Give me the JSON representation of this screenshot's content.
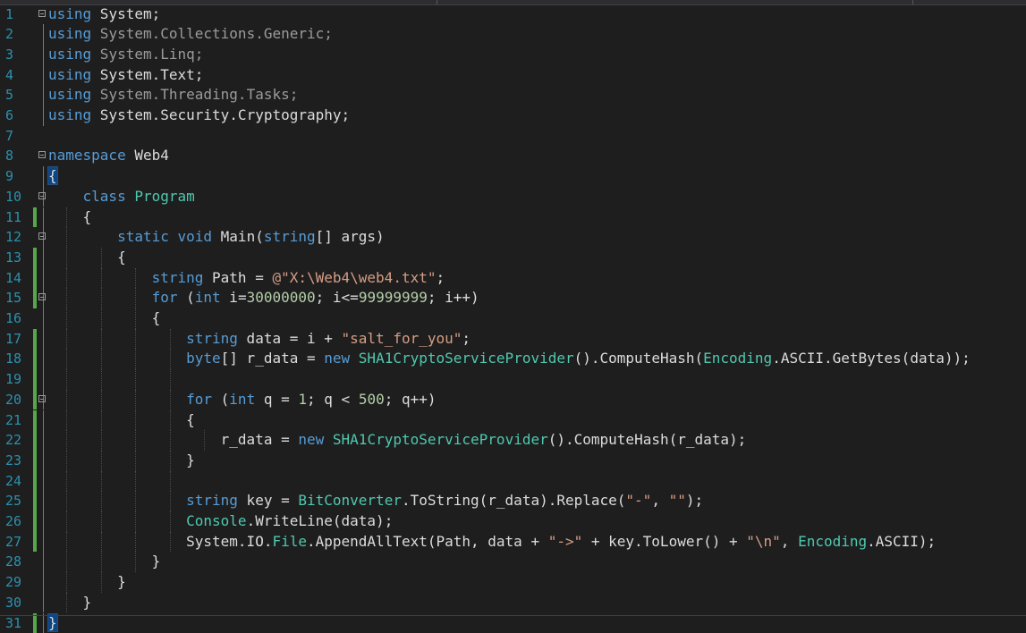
{
  "editor": {
    "lines": [
      {
        "num": "1",
        "fold": true,
        "change": false,
        "guides": [],
        "outline": false,
        "tokens": [
          [
            "kw",
            "using"
          ],
          [
            "pl",
            " System;"
          ]
        ]
      },
      {
        "num": "2",
        "fold": false,
        "change": false,
        "guides": [],
        "outline": true,
        "tokens": [
          [
            "kw",
            "using"
          ],
          [
            "dim",
            " System.Collections.Generic;"
          ]
        ]
      },
      {
        "num": "3",
        "fold": false,
        "change": false,
        "guides": [],
        "outline": true,
        "tokens": [
          [
            "kw",
            "using"
          ],
          [
            "dim",
            " System.Linq;"
          ]
        ]
      },
      {
        "num": "4",
        "fold": false,
        "change": false,
        "guides": [],
        "outline": true,
        "tokens": [
          [
            "kw",
            "using"
          ],
          [
            "pl",
            " System.Text;"
          ]
        ]
      },
      {
        "num": "5",
        "fold": false,
        "change": false,
        "guides": [],
        "outline": true,
        "tokens": [
          [
            "kw",
            "using"
          ],
          [
            "dim",
            " System.Threading.Tasks;"
          ]
        ]
      },
      {
        "num": "6",
        "fold": false,
        "change": false,
        "guides": [],
        "outline": true,
        "tokens": [
          [
            "kw",
            "using"
          ],
          [
            "pl",
            " System.Security.Cryptography;"
          ]
        ]
      },
      {
        "num": "7",
        "fold": false,
        "change": false,
        "guides": [],
        "outline": false,
        "tokens": []
      },
      {
        "num": "8",
        "fold": true,
        "change": false,
        "guides": [],
        "outline": false,
        "tokens": [
          [
            "kw",
            "namespace"
          ],
          [
            "pl",
            " Web4"
          ]
        ]
      },
      {
        "num": "9",
        "fold": false,
        "change": false,
        "guides": [],
        "outline": true,
        "tokens": [
          [
            "hl",
            "{"
          ]
        ]
      },
      {
        "num": "10",
        "fold": true,
        "change": false,
        "guides": [],
        "outline": true,
        "tokens": [
          [
            "pl",
            "    "
          ],
          [
            "kw",
            "class"
          ],
          [
            "pl",
            " "
          ],
          [
            "ty",
            "Program"
          ]
        ]
      },
      {
        "num": "11",
        "fold": false,
        "change": true,
        "guides": [
          1
        ],
        "outline": true,
        "tokens": [
          [
            "pl",
            "    {"
          ]
        ]
      },
      {
        "num": "12",
        "fold": true,
        "change": false,
        "guides": [
          1
        ],
        "outline": true,
        "tokens": [
          [
            "pl",
            "        "
          ],
          [
            "kw",
            "static"
          ],
          [
            "pl",
            " "
          ],
          [
            "kw",
            "void"
          ],
          [
            "pl",
            " Main("
          ],
          [
            "kw",
            "string"
          ],
          [
            "pl",
            "[] args)"
          ]
        ]
      },
      {
        "num": "13",
        "fold": false,
        "change": true,
        "guides": [
          1,
          2
        ],
        "outline": true,
        "tokens": [
          [
            "pl",
            "        {"
          ]
        ]
      },
      {
        "num": "14",
        "fold": false,
        "change": true,
        "guides": [
          1,
          2,
          3
        ],
        "outline": true,
        "tokens": [
          [
            "pl",
            "            "
          ],
          [
            "kw",
            "string"
          ],
          [
            "pl",
            " Path = "
          ],
          [
            "st",
            "@\"X:\\Web4\\web4.txt\""
          ],
          [
            "pl",
            ";"
          ]
        ]
      },
      {
        "num": "15",
        "fold": true,
        "change": true,
        "guides": [
          1,
          2,
          3
        ],
        "outline": true,
        "tokens": [
          [
            "pl",
            "            "
          ],
          [
            "kw",
            "for"
          ],
          [
            "pl",
            " ("
          ],
          [
            "kw",
            "int"
          ],
          [
            "pl",
            " i="
          ],
          [
            "nu",
            "30000000"
          ],
          [
            "pl",
            "; i<="
          ],
          [
            "nu",
            "99999999"
          ],
          [
            "pl",
            "; i++)"
          ]
        ]
      },
      {
        "num": "16",
        "fold": false,
        "change": false,
        "guides": [
          1,
          2,
          3
        ],
        "outline": true,
        "tokens": [
          [
            "pl",
            "            {"
          ]
        ]
      },
      {
        "num": "17",
        "fold": false,
        "change": true,
        "guides": [
          1,
          2,
          3,
          4
        ],
        "outline": true,
        "tokens": [
          [
            "pl",
            "                "
          ],
          [
            "kw",
            "string"
          ],
          [
            "pl",
            " data = i + "
          ],
          [
            "st",
            "\"salt_for_you\""
          ],
          [
            "pl",
            ";"
          ]
        ]
      },
      {
        "num": "18",
        "fold": false,
        "change": true,
        "guides": [
          1,
          2,
          3,
          4
        ],
        "outline": true,
        "tokens": [
          [
            "pl",
            "                "
          ],
          [
            "kw",
            "byte"
          ],
          [
            "pl",
            "[] r_data = "
          ],
          [
            "kw",
            "new"
          ],
          [
            "pl",
            " "
          ],
          [
            "ty",
            "SHA1CryptoServiceProvider"
          ],
          [
            "pl",
            "().ComputeHash("
          ],
          [
            "ty",
            "Encoding"
          ],
          [
            "pl",
            ".ASCII.GetBytes(data));"
          ]
        ]
      },
      {
        "num": "19",
        "fold": false,
        "change": true,
        "guides": [
          1,
          2,
          3,
          4
        ],
        "outline": true,
        "tokens": []
      },
      {
        "num": "20",
        "fold": true,
        "change": true,
        "guides": [
          1,
          2,
          3,
          4
        ],
        "outline": true,
        "tokens": [
          [
            "pl",
            "                "
          ],
          [
            "kw",
            "for"
          ],
          [
            "pl",
            " ("
          ],
          [
            "kw",
            "int"
          ],
          [
            "pl",
            " q = "
          ],
          [
            "nu",
            "1"
          ],
          [
            "pl",
            "; q < "
          ],
          [
            "nu",
            "500"
          ],
          [
            "pl",
            "; q++)"
          ]
        ]
      },
      {
        "num": "21",
        "fold": false,
        "change": true,
        "guides": [
          1,
          2,
          3,
          4
        ],
        "outline": true,
        "tokens": [
          [
            "pl",
            "                {"
          ]
        ]
      },
      {
        "num": "22",
        "fold": false,
        "change": true,
        "guides": [
          1,
          2,
          3,
          4,
          5
        ],
        "outline": true,
        "tokens": [
          [
            "pl",
            "                    r_data = "
          ],
          [
            "kw",
            "new"
          ],
          [
            "pl",
            " "
          ],
          [
            "ty",
            "SHA1CryptoServiceProvider"
          ],
          [
            "pl",
            "().ComputeHash(r_data);"
          ]
        ]
      },
      {
        "num": "23",
        "fold": false,
        "change": true,
        "guides": [
          1,
          2,
          3,
          4
        ],
        "outline": true,
        "tokens": [
          [
            "pl",
            "                }"
          ]
        ]
      },
      {
        "num": "24",
        "fold": false,
        "change": true,
        "guides": [
          1,
          2,
          3,
          4
        ],
        "outline": true,
        "tokens": []
      },
      {
        "num": "25",
        "fold": false,
        "change": true,
        "guides": [
          1,
          2,
          3,
          4
        ],
        "outline": true,
        "tokens": [
          [
            "pl",
            "                "
          ],
          [
            "kw",
            "string"
          ],
          [
            "pl",
            " key = "
          ],
          [
            "ty",
            "BitConverter"
          ],
          [
            "pl",
            ".ToString(r_data).Replace("
          ],
          [
            "st",
            "\"-\""
          ],
          [
            "pl",
            ", "
          ],
          [
            "st",
            "\"\""
          ],
          [
            "pl",
            ");"
          ]
        ]
      },
      {
        "num": "26",
        "fold": false,
        "change": true,
        "guides": [
          1,
          2,
          3,
          4
        ],
        "outline": true,
        "tokens": [
          [
            "pl",
            "                "
          ],
          [
            "ty",
            "Console"
          ],
          [
            "pl",
            ".WriteLine(data);"
          ]
        ]
      },
      {
        "num": "27",
        "fold": false,
        "change": true,
        "guides": [
          1,
          2,
          3,
          4
        ],
        "outline": true,
        "tokens": [
          [
            "pl",
            "                System.IO."
          ],
          [
            "ty",
            "File"
          ],
          [
            "pl",
            ".AppendAllText(Path, data + "
          ],
          [
            "st",
            "\"->\""
          ],
          [
            "pl",
            " + key.ToLower() + "
          ],
          [
            "st",
            "\"\\n\""
          ],
          [
            "pl",
            ", "
          ],
          [
            "ty",
            "Encoding"
          ],
          [
            "pl",
            ".ASCII);"
          ]
        ]
      },
      {
        "num": "28",
        "fold": false,
        "change": false,
        "guides": [
          1,
          2,
          3
        ],
        "outline": true,
        "tokens": [
          [
            "pl",
            "            }"
          ]
        ]
      },
      {
        "num": "29",
        "fold": false,
        "change": false,
        "guides": [
          1,
          2
        ],
        "outline": true,
        "tokens": [
          [
            "pl",
            "        }"
          ]
        ]
      },
      {
        "num": "30",
        "fold": false,
        "change": false,
        "guides": [
          1
        ],
        "outline": true,
        "tokens": [
          [
            "pl",
            "    }"
          ]
        ]
      },
      {
        "num": "31",
        "fold": false,
        "change": true,
        "guides": [],
        "outline": true,
        "tokens": [
          [
            "hl",
            "}"
          ]
        ]
      }
    ],
    "colors": {
      "background": "#1e1e1e",
      "keyword": "#569cd6",
      "type": "#4ec9b0",
      "string": "#d69d85",
      "number": "#b5cea8",
      "plain": "#dcdcdc",
      "line_number": "#2b91af",
      "change_bar": "#57a64a",
      "brace_highlight": "#0e4583"
    }
  }
}
